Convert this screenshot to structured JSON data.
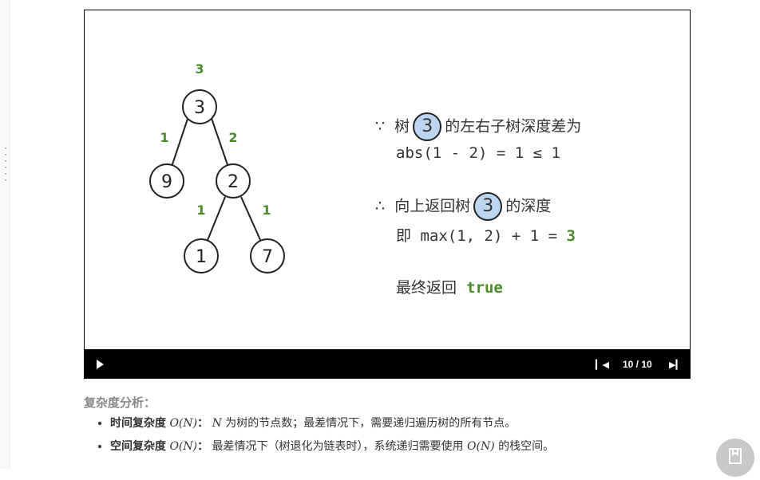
{
  "tree": {
    "root_depth": "3",
    "nodes": [
      "3",
      "9",
      "2",
      "1",
      "7"
    ],
    "edge_labels": [
      "1",
      "2",
      "1",
      "1"
    ]
  },
  "explanation": {
    "because": "∵",
    "line1_pre": "树",
    "node": "3",
    "line1_post": "的左右子树深度差为",
    "line2": "abs(1 - 2) = 1 ≤ 1",
    "therefore": "∴",
    "line3_pre": "向上返回树",
    "line3_post": "的深度",
    "line4_pre": "即 max(1, 2) + 1 = ",
    "line4_result": "3",
    "line5_pre": "最终返回",
    "line5_value": "true"
  },
  "player": {
    "counter": "10 / 10"
  },
  "analysis": {
    "heading": "复杂度分析：",
    "items": [
      {
        "label": "时间复杂度",
        "complexity": "O(N)",
        "colon": "：",
        "var": "N",
        "text": " 为树的节点数；最差情况下，需要递归遍历树的所有节点。"
      },
      {
        "label": "空间复杂度",
        "complexity": "O(N)",
        "colon": "：",
        "text": " 最差情况下（树退化为链表时），系统递归需要使用 ",
        "complexity2": "O(N)",
        "text2": " 的栈空间。"
      }
    ]
  }
}
